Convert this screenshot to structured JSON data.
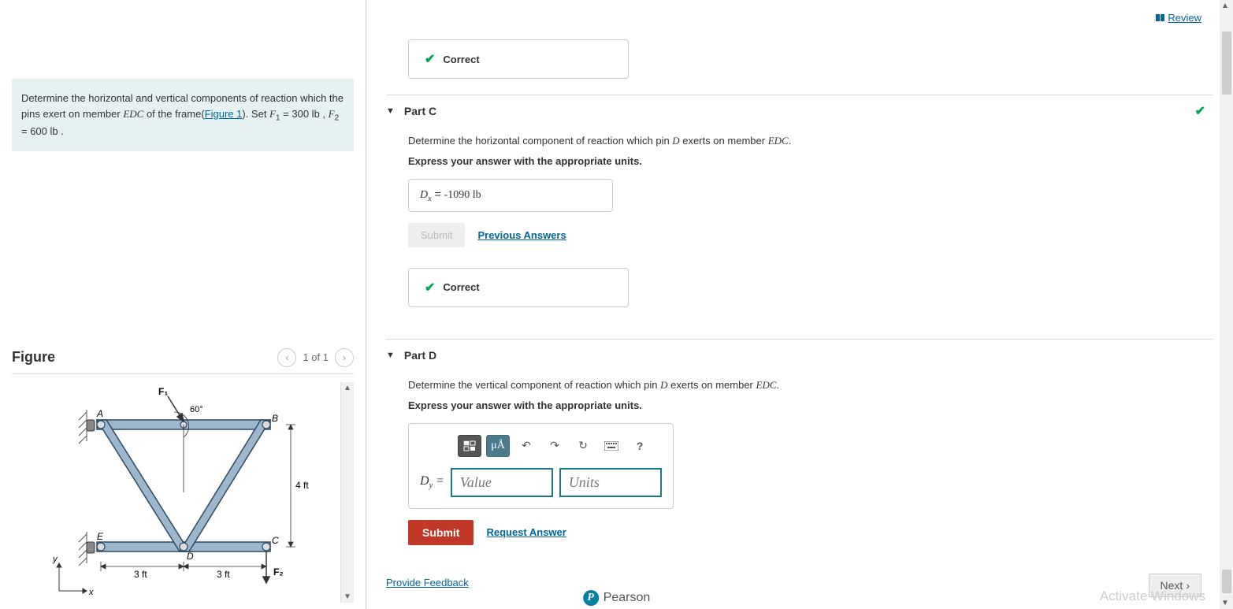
{
  "header": {
    "review": "Review"
  },
  "problem": {
    "text_prefix": "Determine the horizontal and vertical components of reaction which the pins exert on member ",
    "member": "EDC",
    "text_mid": " of the frame(",
    "figure_link": "Figure 1",
    "text_mid2": "). Set ",
    "f1_sym": "F",
    "f1_sub": "1",
    "f1_val": " = 300 lb",
    "sep": " , ",
    "f2_sym": "F",
    "f2_sub": "2",
    "f2_val": " = 600 lb ."
  },
  "figure": {
    "title": "Figure",
    "pager": "1 of 1",
    "labels": {
      "A": "A",
      "B": "B",
      "C": "C",
      "D": "D",
      "E": "E",
      "F1": "F₁",
      "F2": "F₂",
      "angle": "60°",
      "h": "4 ft",
      "w1": "3 ft",
      "w2": "3 ft",
      "x": "x",
      "y": "y"
    }
  },
  "partB": {
    "correct": "Correct"
  },
  "partC": {
    "title": "Part C",
    "instruction_pre": "Determine the horizontal component of reaction which pin ",
    "pin": "D",
    "instruction_mid": " exerts on member ",
    "member": "EDC",
    "instruction_post": ".",
    "instruction2": "Express your answer with the appropriate units.",
    "answer_sym": "D",
    "answer_sub": "x",
    "answer_eq": " = ",
    "answer_val": "-1090",
    "answer_unit": " lb",
    "submit": "Submit",
    "prev": "Previous Answers",
    "correct": "Correct"
  },
  "partD": {
    "title": "Part D",
    "instruction_pre": "Determine the vertical component of reaction which pin ",
    "pin": "D",
    "instruction_mid": " exerts on member ",
    "member": "EDC",
    "instruction_post": ".",
    "instruction2": "Express your answer with the appropriate units.",
    "answer_sym": "D",
    "answer_sub": "y",
    "answer_eq": " = ",
    "value_placeholder": "Value",
    "units_placeholder": "Units",
    "toolbar": {
      "units": "μÅ",
      "help": "?"
    },
    "submit": "Submit",
    "request": "Request Answer"
  },
  "footer": {
    "feedback": "Provide Feedback",
    "next": "Next",
    "brand": "Pearson",
    "watermark": "Activate Windows"
  }
}
